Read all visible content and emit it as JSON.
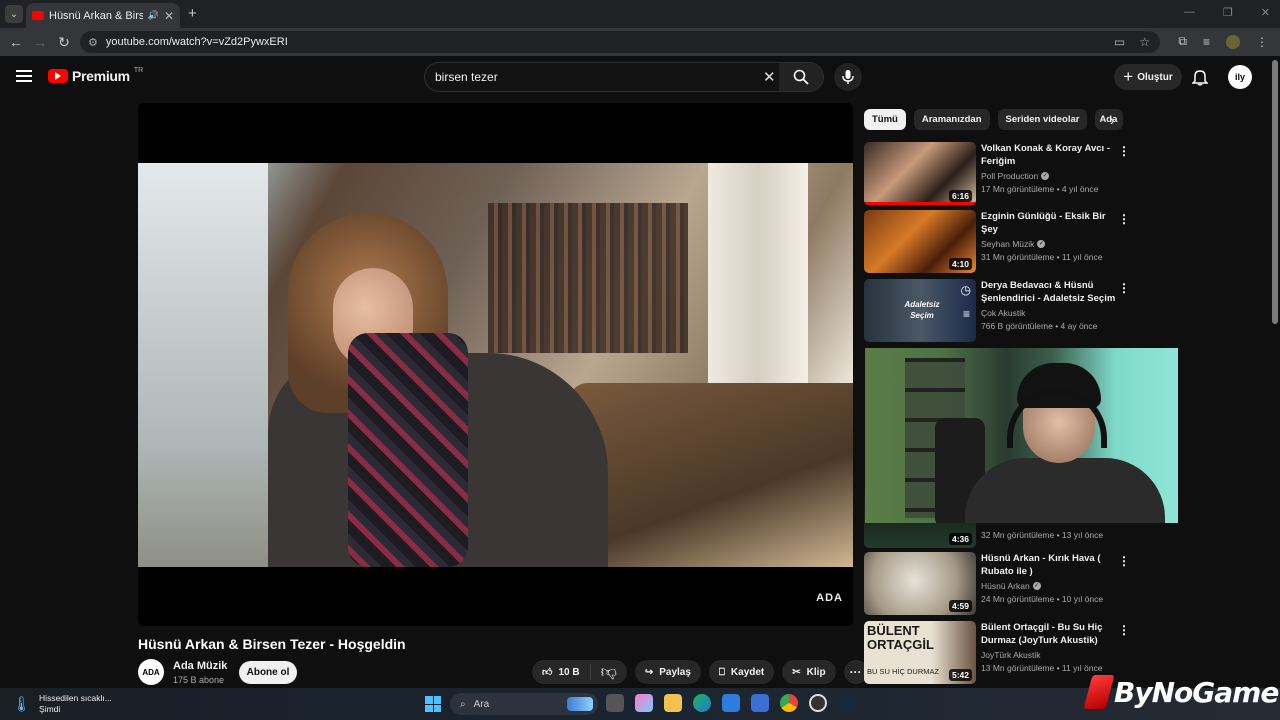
{
  "browser": {
    "tab_title": "Hüsnü Arkan & Birsen Tezer",
    "url": "youtube.com/watch?v=vZd2PywxERI",
    "tab_close": "✕",
    "new_tab": "+"
  },
  "header": {
    "logo_text": "Premium",
    "logo_region": "TR",
    "search_value": "birsen tezer",
    "create_label": "Oluştur",
    "avatar_text": "ily"
  },
  "video": {
    "title": "Hüsnü Arkan & Birsen Tezer - Hoşgeldin",
    "watermark": "ADA",
    "channel_avatar": "ADA",
    "channel_name": "Ada Müzik",
    "subscribers": "175 B abone",
    "subscribe_label": "Abone ol",
    "likes": "10 B",
    "share_label": "Paylaş",
    "save_label": "Kaydet",
    "clip_label": "Klip",
    "more": "···"
  },
  "chips": [
    "Tümü",
    "Aramanızdan",
    "Seriden videolar",
    "Ada"
  ],
  "recommendations": [
    {
      "title": "Volkan Konak & Koray Avcı - Feriğim",
      "channel": "Poll Production",
      "verified": true,
      "meta": "17 Mn görüntüleme • 4 yıl önce",
      "duration": "6:16",
      "progress": 1.0
    },
    {
      "title": "Ezginin Günlüğü - Eksik Bir Şey",
      "channel": "Seyhan Müzik",
      "verified": true,
      "meta": "31 Mn görüntüleme • 11 yıl önce",
      "duration": "4:10"
    },
    {
      "title": "Derya Bedavacı & Hüsnü Şenlendirici - Adaletsiz Seçim",
      "channel": "Çok Akustik",
      "verified": false,
      "meta": "766 B görüntüleme • 4 ay önce",
      "thumb_text": "Adaletsiz Seçim"
    },
    {
      "title": "",
      "channel": "",
      "verified": false,
      "meta": "32 Mn görüntüleme • 13 yıl önce",
      "duration": "4:36"
    },
    {
      "title": "Hüsnü Arkan - Kırık Hava ( Rubato ile )",
      "channel": "Hüsnü Arkan",
      "verified": true,
      "meta": "24 Mn görüntüleme • 10 yıl önce",
      "duration": "4:59"
    },
    {
      "title": "Bülent Ortaçgil - Bu Su Hiç Durmaz (JoyTurk Akustik)",
      "channel": "JoyTürk Akustik",
      "verified": false,
      "meta": "13 Mn görüntüleme • 11 yıl önce",
      "duration": "5:42",
      "thumb_text": "BÜLENT ORTAÇGİL",
      "thumb_sub": "BU SU HİÇ DURMAZ"
    }
  ],
  "taskbar": {
    "weather_line1": "Hissedilen sıcaklı...",
    "weather_line2": "Şimdi",
    "search_placeholder": "Ara"
  },
  "brand": "ByNoGame",
  "colors": {
    "accent": "#ff0000",
    "background": "#0f0f0f",
    "chip_active": "#f1f1f1"
  }
}
